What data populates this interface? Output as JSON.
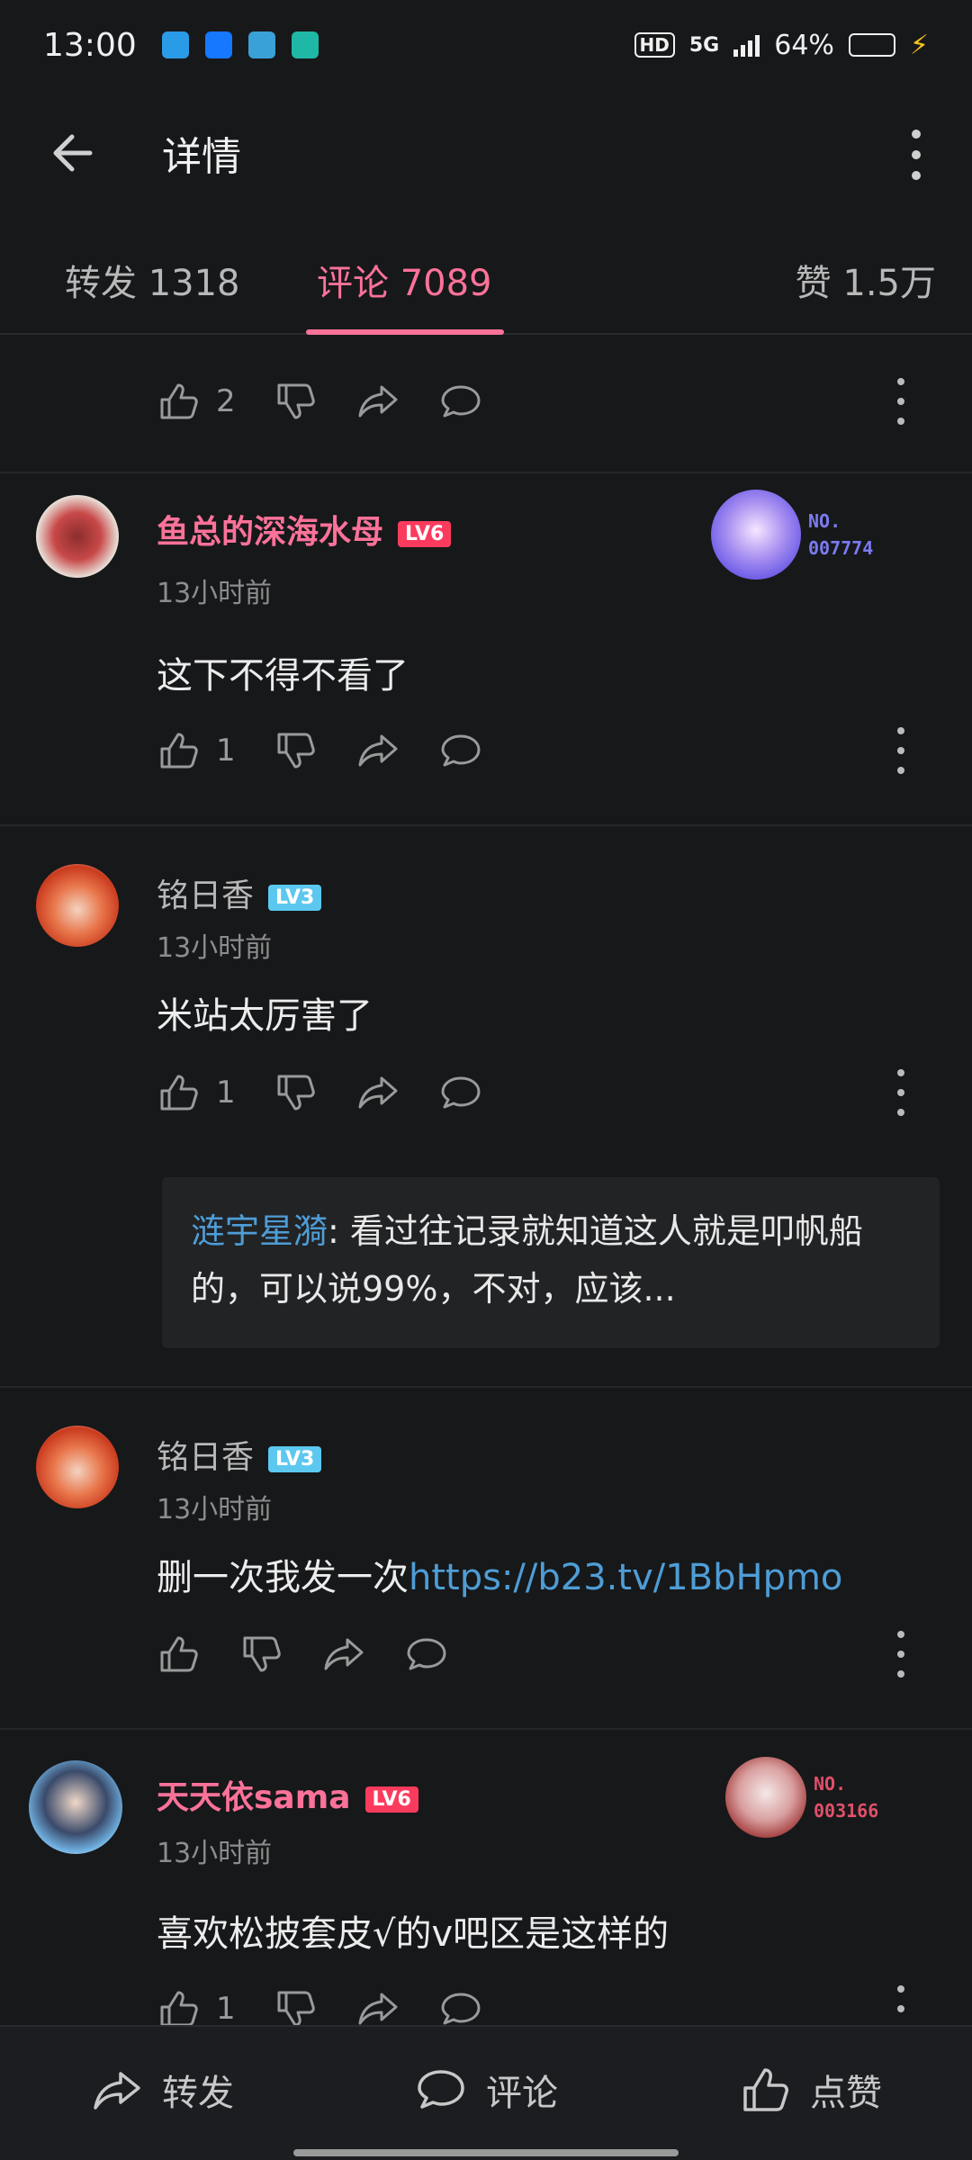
{
  "status_bar": {
    "time": "13:00",
    "hd": "HD",
    "net": "5G",
    "battery": "64%",
    "battery_level": 0.64
  },
  "header": {
    "title": "详情"
  },
  "tabs": [
    {
      "label": "转发 1318"
    },
    {
      "label": "评论 7089"
    },
    {
      "label": "赞 1.5万"
    }
  ],
  "active_tab": 1,
  "top_actions": {
    "like_count": "2"
  },
  "comments": [
    {
      "username": "鱼总的深海水母",
      "level": "LV6",
      "time": "13小时前",
      "text": "这下不得不看了",
      "like_count": "1",
      "badge_no": "NO.",
      "badge_num": "007774"
    },
    {
      "username": "铭日香",
      "level": "LV3",
      "time": "13小时前",
      "text": "米站太厉害了",
      "like_count": "1",
      "reply_name": "涟宇星漪",
      "reply_text": ": 看过往记录就知道这人就是叩帆船的，可以说99%，不对，应该..."
    },
    {
      "username": "铭日香",
      "level": "LV3",
      "time": "13小时前",
      "text": "删一次我发一次",
      "link": "https://b23.tv/1BbHpmo"
    },
    {
      "username": "天天依sama",
      "level": "LV6",
      "time": "13小时前",
      "text": "喜欢松披套皮√的v吧区是这样的",
      "like_count": "1",
      "badge_no": "NO.",
      "badge_num": "003166"
    }
  ],
  "bottom_bar": {
    "share": "转发",
    "comment": "评论",
    "like": "点赞"
  },
  "colors": {
    "accent": "#fb7299",
    "link": "#4e9dd6",
    "background": "#17181a"
  }
}
